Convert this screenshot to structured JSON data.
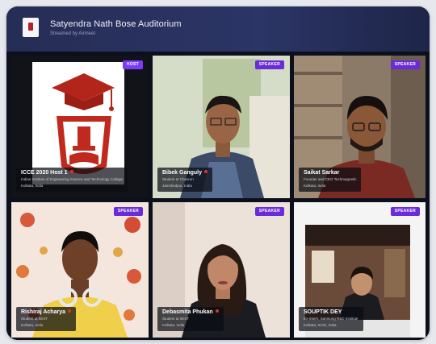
{
  "header": {
    "title": "Satyendra Nath Bose Auditorium",
    "subtitle": "Streamed by Airmeet"
  },
  "badge_colors": {
    "host": "#7b3bff",
    "speaker": "#6a2bd9"
  },
  "tiles": [
    {
      "badge": "HOST",
      "name": "ICCE 2020 Host 1",
      "line1": "Indian Institute of Engineering Science and Technology College",
      "line2": "Kolkata, India",
      "mic_muted": true,
      "icon": "college-crest-logo"
    },
    {
      "badge": "SPEAKER",
      "name": "Bibek Ganguly",
      "line1": "Student at Chevron",
      "line2": "Jamshedpur, India",
      "mic_muted": true
    },
    {
      "badge": "SPEAKER",
      "name": "Saikat Sarkar",
      "line1": "Founder and CEO Techmagnetic",
      "line2": "Kolkata, India",
      "mic_muted": false
    },
    {
      "badge": "SPEAKER",
      "name": "Rishiraj Acharya",
      "line1": "Student at IIEST",
      "line2": "Kolkata, India",
      "mic_muted": true
    },
    {
      "badge": "SPEAKER",
      "name": "Debasmita Phukan",
      "line1": "Student at IIEST",
      "line2": "Kolkata, India",
      "mic_muted": true
    },
    {
      "badge": "SPEAKER",
      "name": "SOUPTIK DEY",
      "line1": "Ex-Intern, Samsung R&D Institute",
      "line2": "Kolkata, ICCE, India",
      "mic_muted": false
    }
  ]
}
